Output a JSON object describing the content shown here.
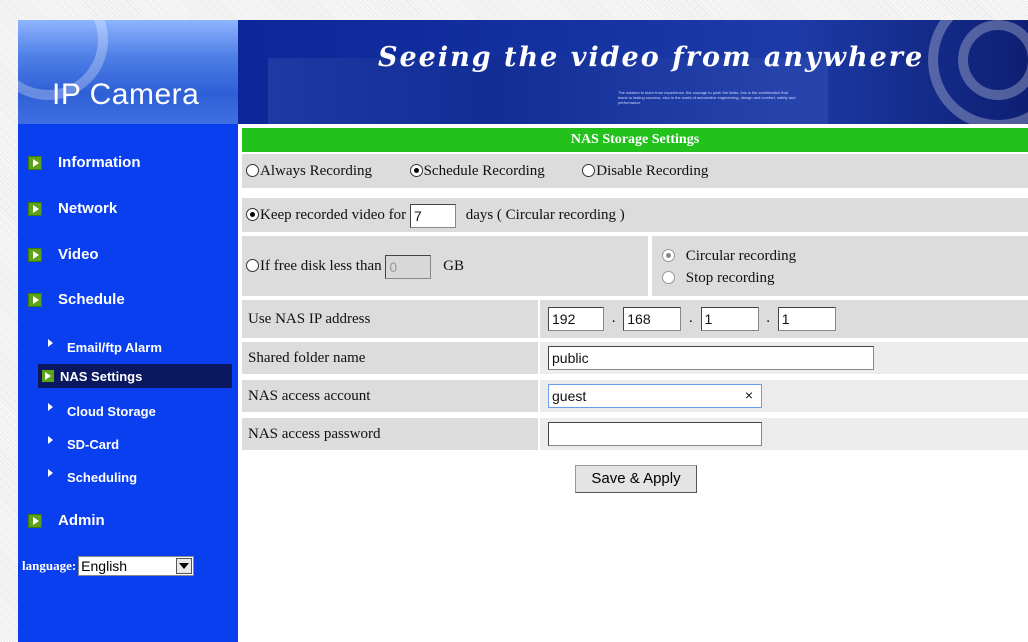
{
  "banner": {
    "logo": "IP Camera",
    "slogan": "Seeing the video from anywhere",
    "fine_print": "The wisdom to learn from experience, the courage to push the limits. this is the combination that leads to lasting success, also in the world of automotive engineering, design and comfort, safety and performance"
  },
  "sidebar": {
    "items": [
      {
        "label": "Information"
      },
      {
        "label": "Network"
      },
      {
        "label": "Video"
      },
      {
        "label": "Schedule"
      },
      {
        "label": "Admin"
      }
    ],
    "sub_items": [
      {
        "label": "Email/ftp Alarm"
      },
      {
        "label": "NAS Settings"
      },
      {
        "label": "Cloud Storage"
      },
      {
        "label": "SD-Card"
      },
      {
        "label": "Scheduling"
      }
    ],
    "language_label": "language:",
    "language_value": "English"
  },
  "nas": {
    "title": "NAS Storage Settings",
    "mode": {
      "always": "Always Recording",
      "schedule": "Schedule Recording",
      "disable": "Disable Recording",
      "selected": "schedule"
    },
    "keep": {
      "prefix": "Keep recorded video for",
      "days_value": "7",
      "suffix": "days ( Circular recording )"
    },
    "free_disk": {
      "prefix": "If free disk less than",
      "gb_value": "0",
      "suffix": "GB",
      "circular": "Circular recording",
      "stop": "Stop recording"
    },
    "ip": {
      "label": "Use NAS IP address",
      "octets": [
        "192",
        "168",
        "1",
        "1"
      ],
      "separator": "."
    },
    "folder": {
      "label": "Shared folder name",
      "value": "public"
    },
    "account": {
      "label": "NAS access account",
      "value": "guest",
      "clear": "×"
    },
    "password": {
      "label": "NAS access password",
      "value": ""
    },
    "save_label": "Save & Apply"
  }
}
